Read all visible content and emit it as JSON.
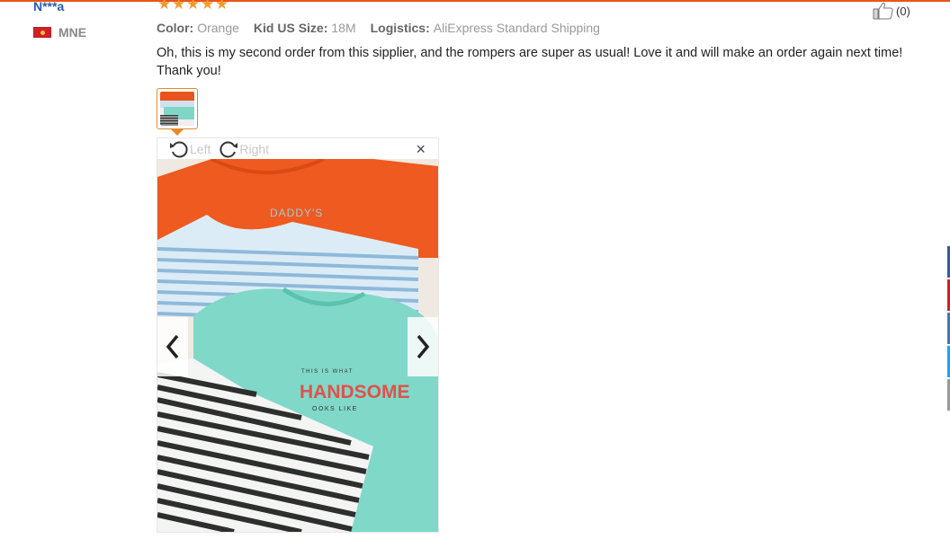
{
  "reviewer": {
    "name": "N***a",
    "country_code": "MNE",
    "rating": 5
  },
  "like": {
    "count_label": "(0)"
  },
  "attributes": [
    {
      "label": "Color:",
      "value": "Orange"
    },
    {
      "label": "Kid US Size:",
      "value": "18M"
    },
    {
      "label": "Logistics:",
      "value": "AliExpress Standard Shipping"
    }
  ],
  "review_text": "Oh, this is my second order from this sipplier, and the rompers are super as usual! Love it and will make an order again next time! Thank you!",
  "viewer": {
    "rotate_left_label": "Left",
    "rotate_right_label": "Right",
    "close_label": "×",
    "photo_print_1": "DADDY'S",
    "photo_print_2": "THIS IS WHAT",
    "photo_print_3": "HANDSOME",
    "photo_print_4": "OOKS LIKE"
  },
  "colors": {
    "accent": "#e8541c",
    "name_link": "#2a5aa8",
    "star": "#f39a2b",
    "edge_tabs": [
      "#3b5998",
      "#c8232c",
      "#4a76a8",
      "#1da1f2",
      "#999999"
    ]
  },
  "icons": {
    "star": "★",
    "thumb": "thumbs-up-icon",
    "rotate_left": "rotate-left-icon",
    "rotate_right": "rotate-right-icon",
    "prev": "chevron-left-icon",
    "next": "chevron-right-icon"
  }
}
